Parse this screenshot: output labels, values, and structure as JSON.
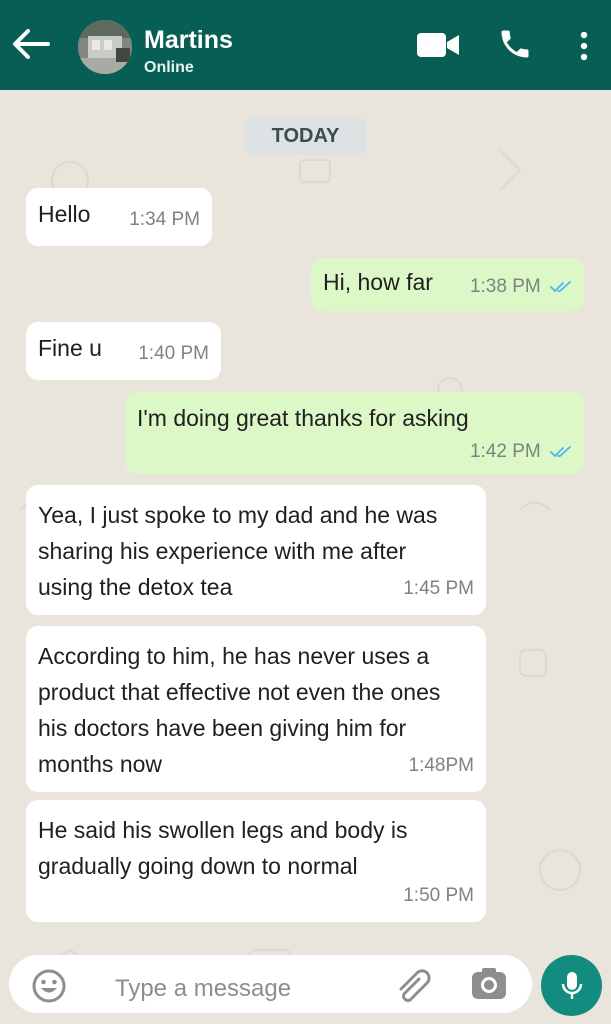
{
  "header": {
    "back_icon": "arrow-left-icon",
    "contact_name": "Martins",
    "status": "Online",
    "icons": [
      "video-call-icon",
      "phone-icon",
      "more-vertical-icon"
    ]
  },
  "chat": {
    "date_label": "TODAY",
    "messages": [
      {
        "dir": "in",
        "text": "Hello",
        "time": "1:34 PM"
      },
      {
        "dir": "out",
        "text": "Hi, how far",
        "time": "1:38 PM",
        "read": true
      },
      {
        "dir": "in",
        "text": "Fine u",
        "time": "1:40 PM"
      },
      {
        "dir": "out",
        "text": "I'm doing great thanks for asking",
        "time": "1:42 PM",
        "read": true
      },
      {
        "dir": "in",
        "text": "Yea, I just spoke to my dad and he was sharing his experience with me after using the detox tea",
        "time": "1:45 PM"
      },
      {
        "dir": "in",
        "text": "According to him, he has never uses a product that effective not even the ones his doctors have been giving him for months now",
        "time": "1:48PM"
      },
      {
        "dir": "in",
        "text": "He said his swollen legs and body is gradually going down to normal",
        "time": "1:50 PM"
      }
    ]
  },
  "composer": {
    "placeholder": "Type a message",
    "icons": [
      "emoji-icon",
      "attach-icon",
      "camera-icon",
      "mic-icon"
    ]
  },
  "colors": {
    "header": "#075e54",
    "incoming_bubble": "#ffffff",
    "outgoing_bubble": "#dcf8c6",
    "read_ticks": "#4fb6ec",
    "mic_button": "#128c7e"
  }
}
